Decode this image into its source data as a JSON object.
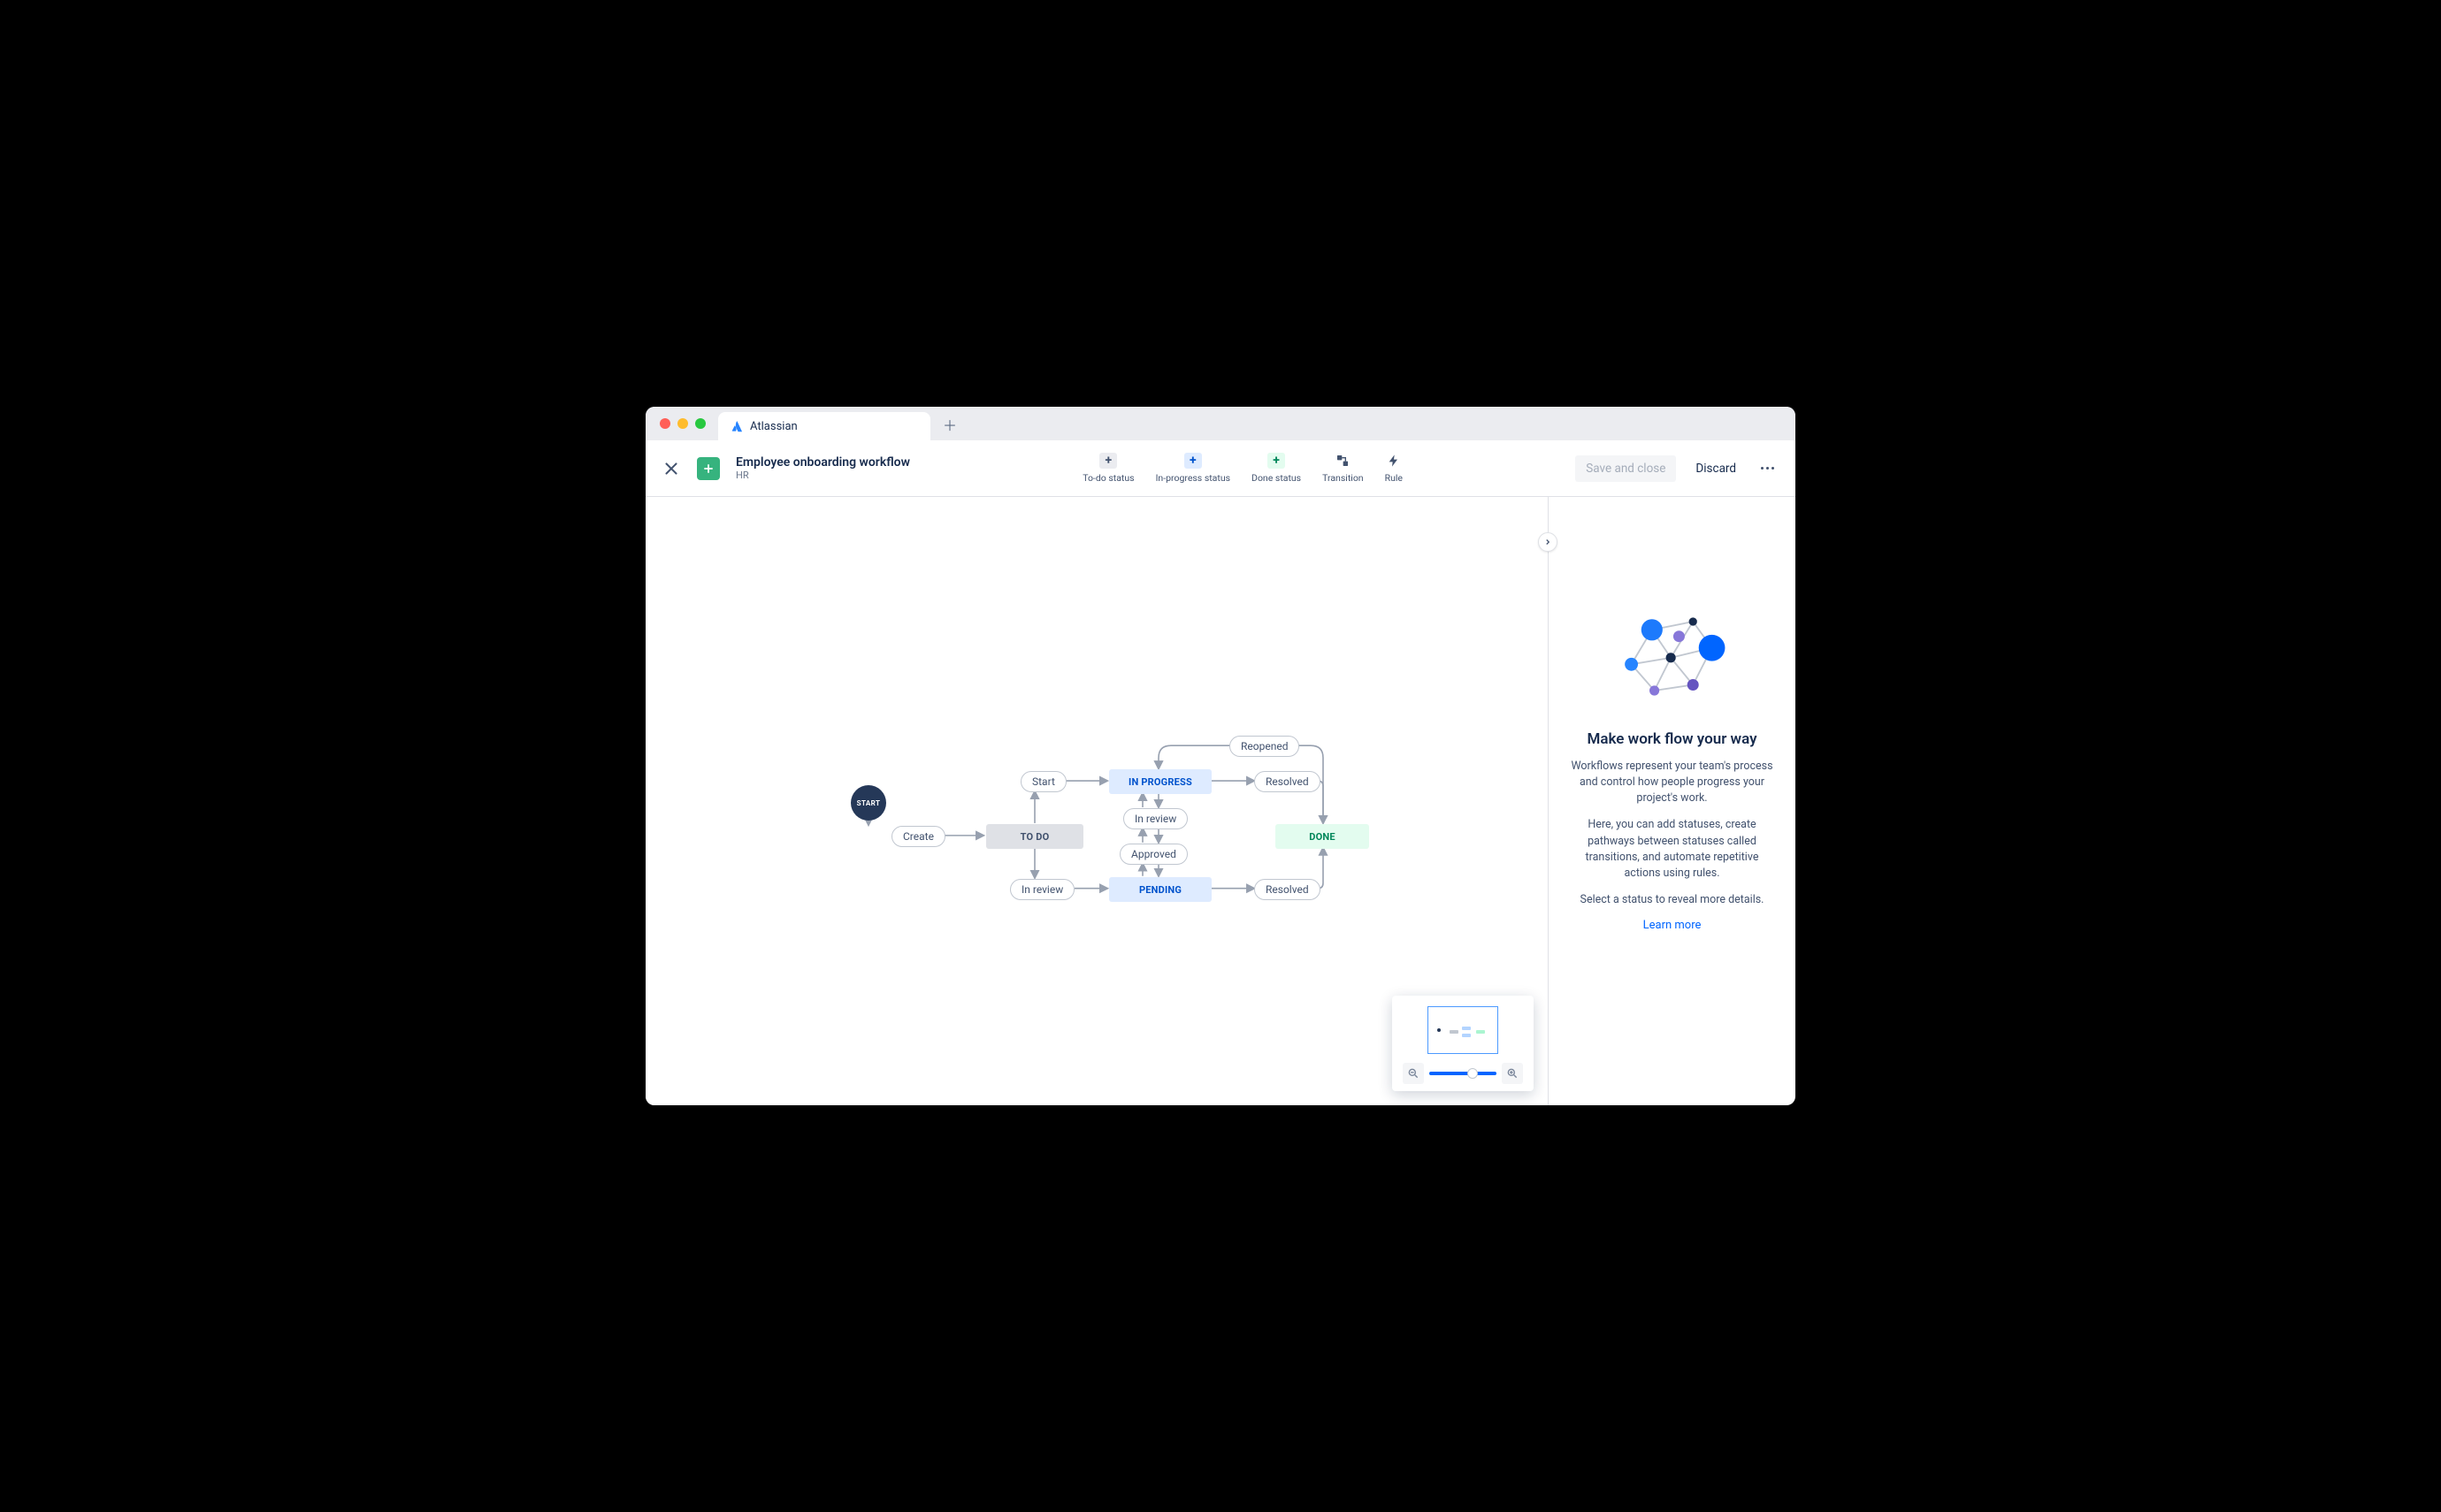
{
  "browser": {
    "tab_title": "Atlassian"
  },
  "header": {
    "title": "Employee onboarding workflow",
    "subtitle": "HR",
    "tools": {
      "todo": "To-do status",
      "inprogress": "In-progress status",
      "done": "Done status",
      "transition": "Transition",
      "rule": "Rule"
    },
    "save_label": "Save and close",
    "discard_label": "Discard"
  },
  "workflow": {
    "start_label": "START",
    "statuses": {
      "todo": "TO DO",
      "in_progress": "IN PROGRESS",
      "pending": "PENDING",
      "done": "DONE"
    },
    "transitions": {
      "create": "Create",
      "start": "Start",
      "in_review_top": "In review",
      "approved": "Approved",
      "in_review_left": "In review",
      "reopened": "Reopened",
      "resolved_top": "Resolved",
      "resolved_bottom": "Resolved"
    }
  },
  "panel": {
    "heading": "Make work flow your way",
    "p1": "Workflows represent your team's process and control how people progress your project's work.",
    "p2": "Here, you can add statuses, create pathways between statuses called transitions, and automate repetitive actions using rules.",
    "p3": "Select a status to reveal more details.",
    "learn_more": "Learn more"
  }
}
